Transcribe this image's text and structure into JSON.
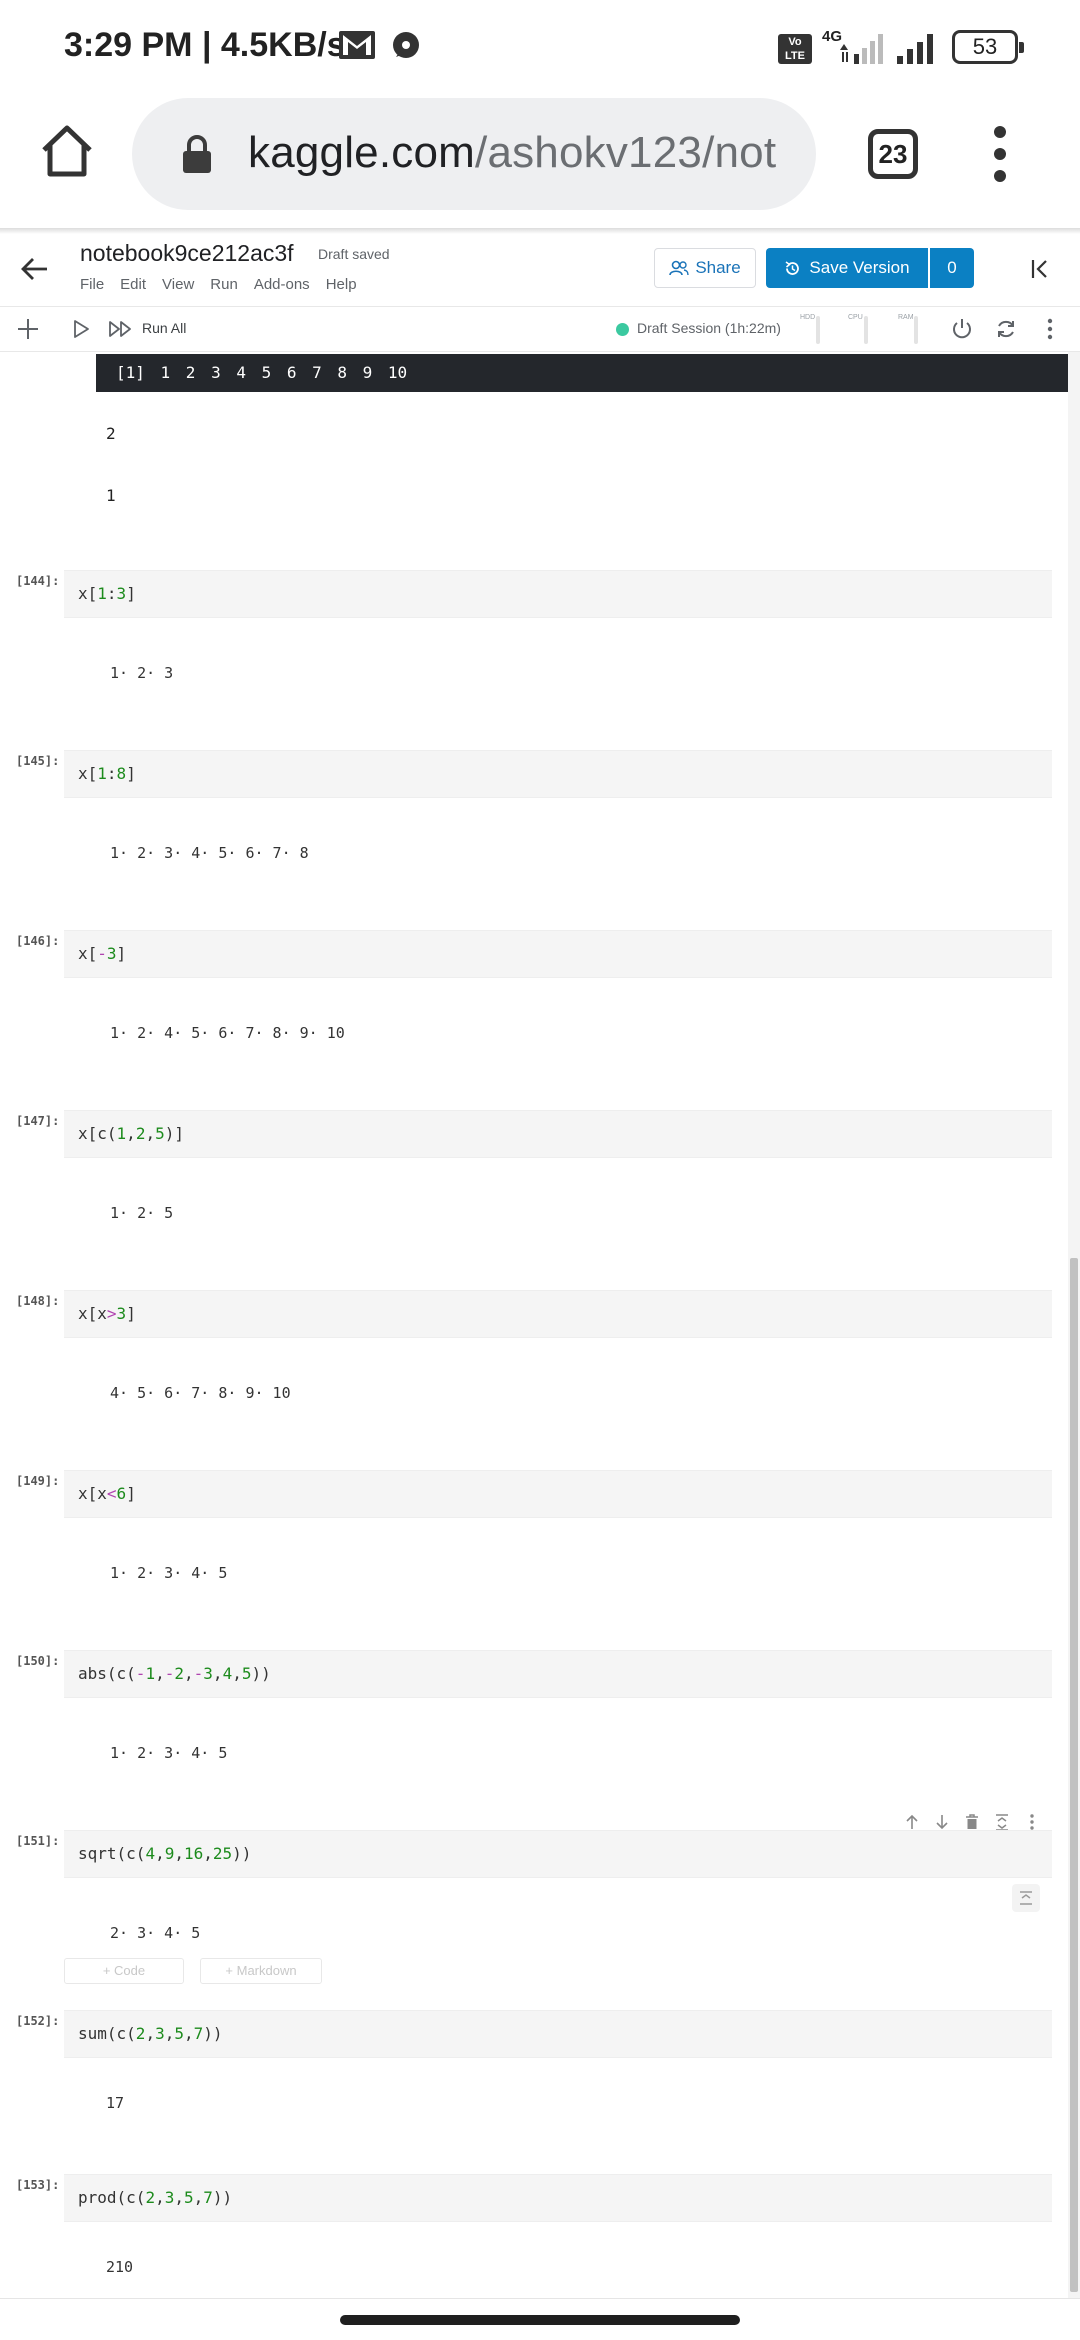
{
  "status_bar": {
    "time": "3:29 PM | 4.5KB/s",
    "volte": "Vo LTE",
    "network": "4G",
    "battery": "53"
  },
  "browser": {
    "url_host": "kaggle.com",
    "url_path": "/ashokv123/not",
    "tab_count": "23"
  },
  "header": {
    "title": "notebook9ce212ac3f",
    "save_status": "Draft saved",
    "menu": [
      "File",
      "Edit",
      "View",
      "Run",
      "Add-ons",
      "Help"
    ],
    "share_label": "Share",
    "save_version_label": "Save Version",
    "version_count": "0"
  },
  "toolbar": {
    "run_all_label": "Run All",
    "session_label": "Draft Session (1h:22m)",
    "meters": [
      "HDD",
      "CPU",
      "RAM"
    ]
  },
  "accent_colors": {
    "save_button": "#0b80c3",
    "session_dot": "#3bc9a0",
    "number_literal": "#1c8b1c",
    "operator": "#b044b0"
  },
  "top_output": {
    "dark_line": "[1] 1 2 3 4 5 6 7 8 9 10",
    "lines": [
      "2",
      "1"
    ]
  },
  "cells": [
    {
      "number": "[144]:",
      "code": "x[1:3]",
      "output": "1· 2· 3"
    },
    {
      "number": "[145]:",
      "code": "x[1:8]",
      "output": "1· 2· 3· 4· 5· 6· 7· 8"
    },
    {
      "number": "[146]:",
      "code": "x[-3]",
      "output": "1· 2· 4· 5· 6· 7· 8· 9· 10"
    },
    {
      "number": "[147]:",
      "code": "x[c(1,2,5)]",
      "output": "1· 2· 5"
    },
    {
      "number": "[148]:",
      "code": "x[x>3]",
      "output": "4· 5· 6· 7· 8· 9· 10"
    },
    {
      "number": "[149]:",
      "code": "x[x<6]",
      "output": "1· 2· 3· 4· 5"
    },
    {
      "number": "[150]:",
      "code": "abs(c(-1,-2,-3,4,5))",
      "output": "1· 2· 3· 4· 5"
    },
    {
      "number": "[151]:",
      "code": "sqrt(c(4,9,16,25))",
      "output": "2· 3· 4· 5"
    },
    {
      "number": "[152]:",
      "code": "sum(c(2,3,5,7))",
      "output": "17"
    },
    {
      "number": "[153]:",
      "code": "prod(c(2,3,5,7))",
      "output": "210"
    }
  ],
  "add_cell": {
    "code_label": "+ Code",
    "markdown_label": "+ Markdown"
  }
}
